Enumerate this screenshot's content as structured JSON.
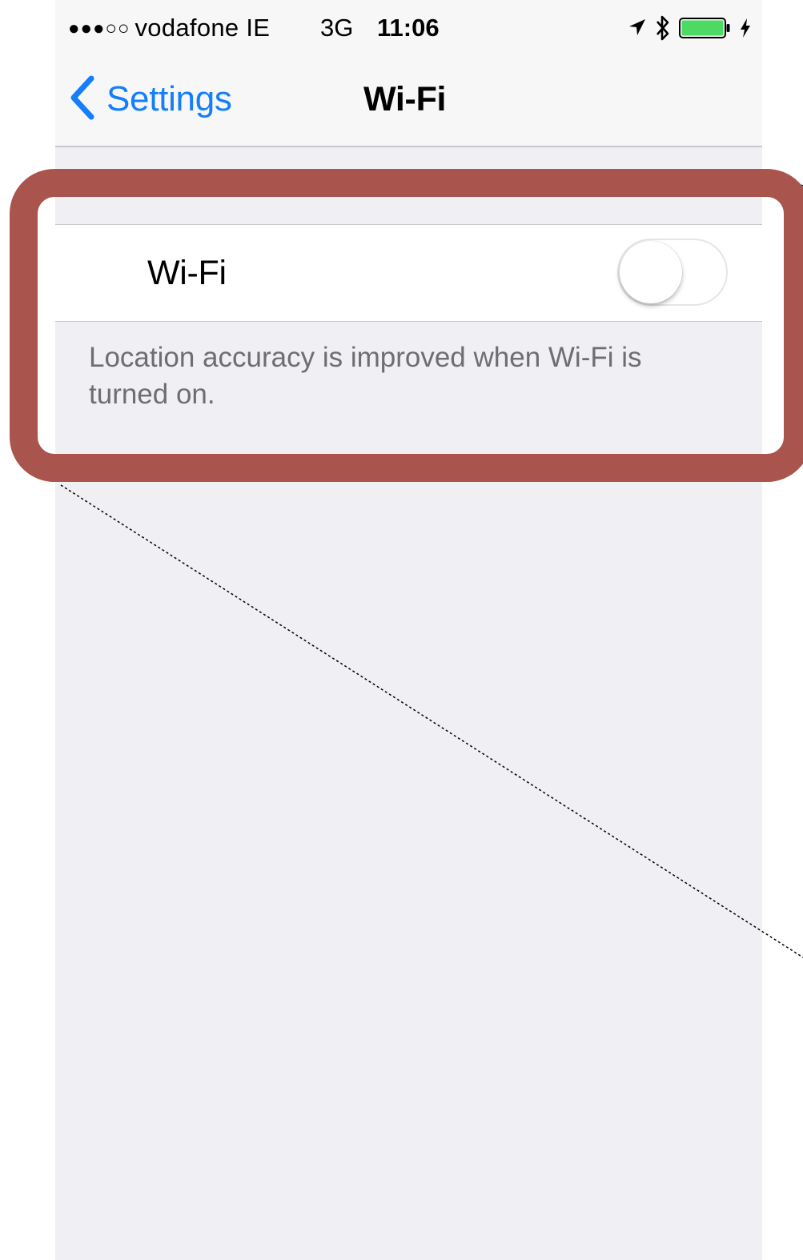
{
  "status_bar": {
    "signal_dots": "●●●○○",
    "carrier": "vodafone IE",
    "network": "3G",
    "time": "11:06",
    "icons": [
      "location-arrow-icon",
      "bluetooth-icon",
      "battery-icon",
      "charging-bolt-icon"
    ],
    "battery_level": 1.0
  },
  "nav": {
    "back_label": "Settings",
    "title": "Wi-Fi",
    "accent_color": "#147efb"
  },
  "wifi_section": {
    "row_label": "Wi-Fi",
    "toggle_on": false,
    "footer": "Location accuracy is improved when Wi-Fi is turned on."
  },
  "annotation": {
    "highlight_color": "#a9554d"
  }
}
